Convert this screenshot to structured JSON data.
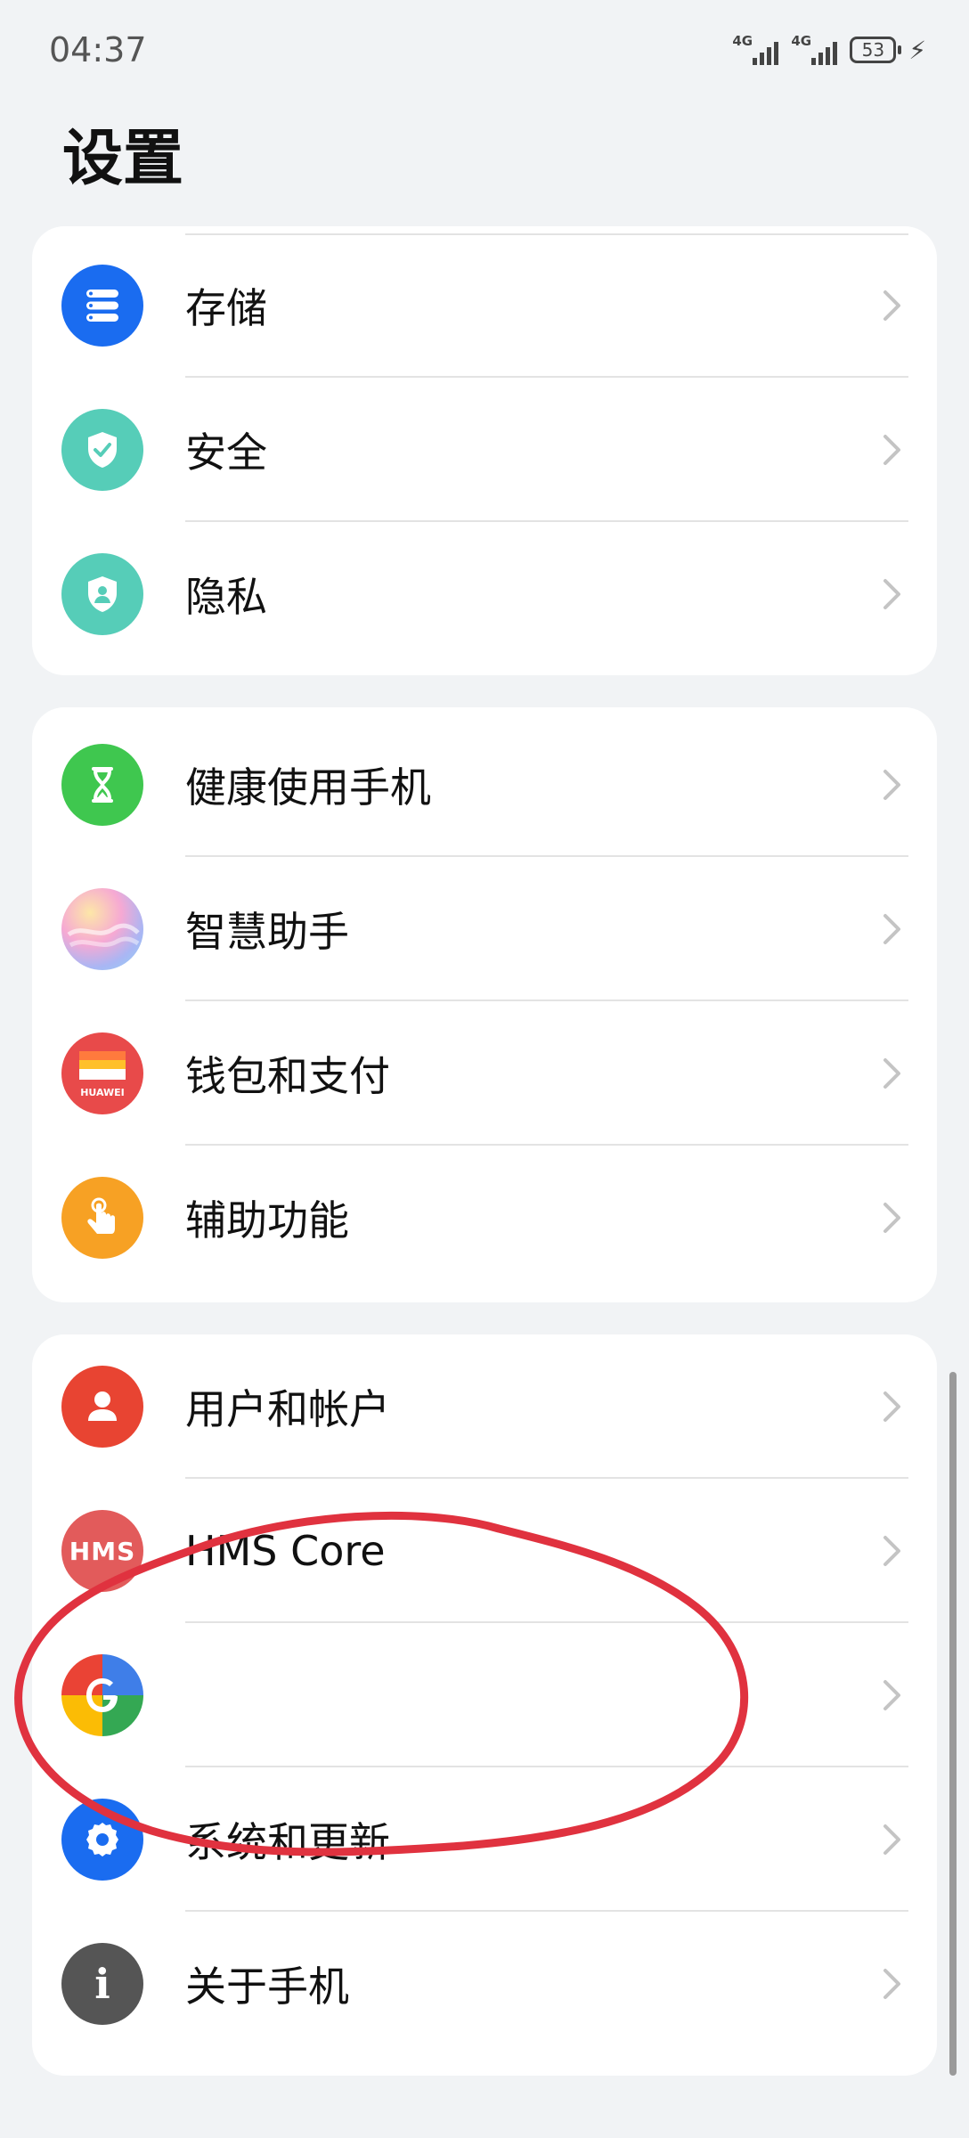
{
  "status_bar": {
    "time": "04:37",
    "network1": "4G",
    "network2": "4G",
    "battery": "53"
  },
  "page": {
    "title": "设置"
  },
  "groups": [
    {
      "items": [
        {
          "label": "存储",
          "icon": "storage-icon",
          "color": "#1a6cf0"
        },
        {
          "label": "安全",
          "icon": "security-shield-icon",
          "color": "#56cdb8"
        },
        {
          "label": "隐私",
          "icon": "privacy-icon",
          "color": "#56cdb8"
        }
      ]
    },
    {
      "items": [
        {
          "label": "健康使用手机",
          "icon": "hourglass-icon",
          "color": "#3fc74f"
        },
        {
          "label": "智慧助手",
          "icon": "smart-assistant-icon",
          "color": "#f0a6d6"
        },
        {
          "label": "钱包和支付",
          "icon": "wallet-icon",
          "color": "#e84a4a"
        },
        {
          "label": "辅助功能",
          "icon": "accessibility-hand-icon",
          "color": "#f7a124"
        }
      ]
    },
    {
      "items": [
        {
          "label": "用户和帐户",
          "icon": "user-icon",
          "color": "#e84432"
        },
        {
          "label": "HMS Core",
          "icon": "hms-core-icon",
          "color": "#e25b5b",
          "icon_text": "HMS"
        },
        {
          "label": "",
          "icon": "google-icon",
          "color": "#ffffff"
        },
        {
          "label": "系统和更新",
          "icon": "gear-icon",
          "color": "#1a6cf0"
        },
        {
          "label": "关于手机",
          "icon": "info-icon",
          "color": "#555555",
          "icon_text": "i"
        }
      ]
    }
  ],
  "wallet_brand": "HUAWEI",
  "annotation": {
    "color": "#e0323f"
  }
}
